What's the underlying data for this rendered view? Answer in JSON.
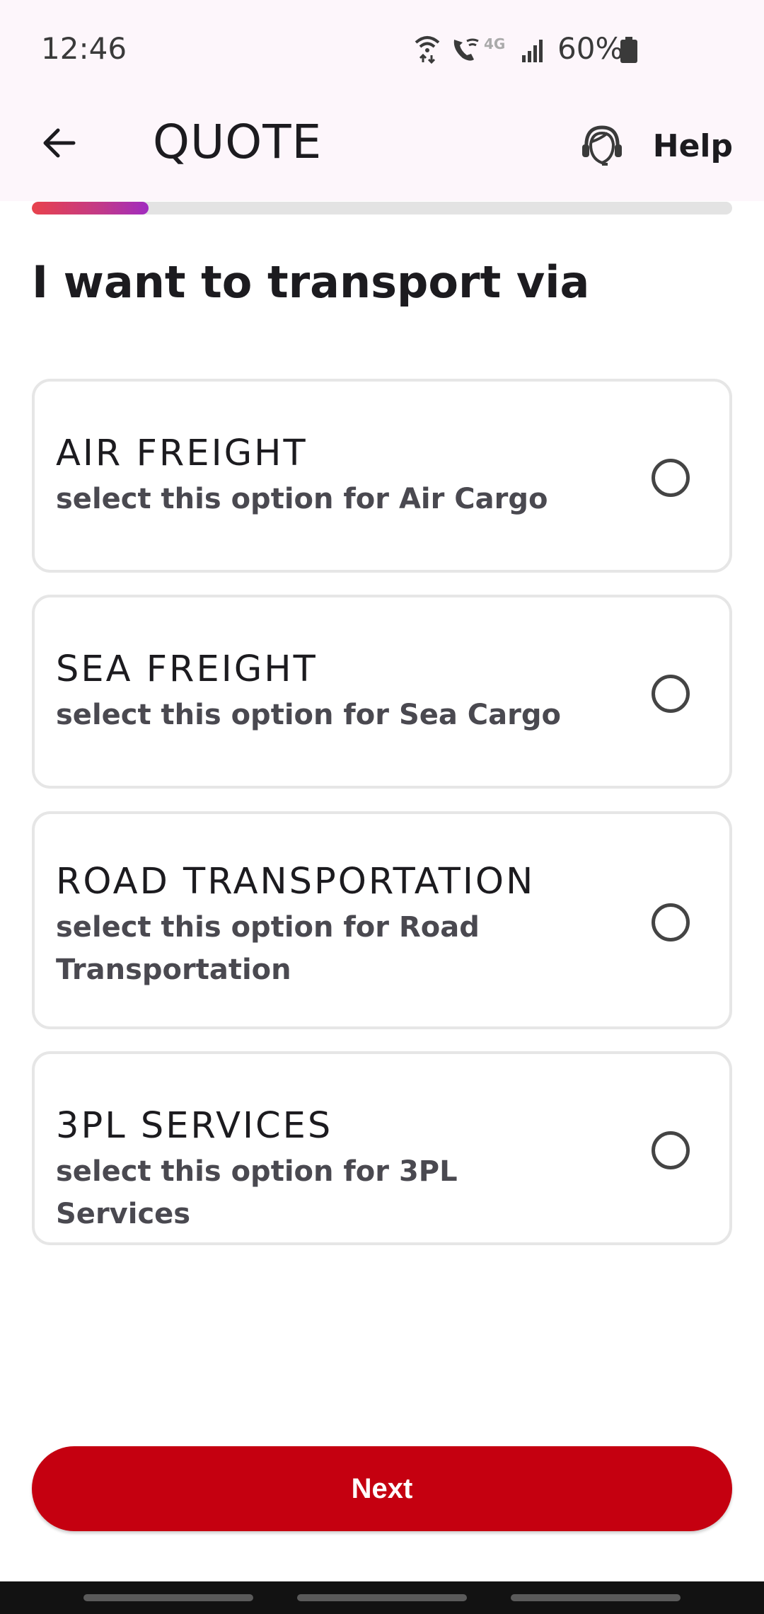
{
  "status_bar": {
    "time": "12:46",
    "battery_percent": "60%",
    "network_label": "4G",
    "icons": [
      "wifi-icon",
      "wifi-calling-icon",
      "signal-icon",
      "battery-icon"
    ]
  },
  "app_bar": {
    "title": "QUOTE",
    "back_icon": "arrow-left-icon",
    "help_label": "Help",
    "help_icon": "headset-agent-icon"
  },
  "progress": {
    "fraction": 0.167
  },
  "heading": "I want to transport via",
  "options": [
    {
      "title": "AIR FREIGHT",
      "subtitle": "select this option for Air Cargo",
      "selected": false
    },
    {
      "title": "SEA FREIGHT",
      "subtitle": "select this option for Sea Cargo",
      "selected": false
    },
    {
      "title": "ROAD TRANSPORTATION",
      "subtitle": "select this option for Road Transportation",
      "selected": false
    },
    {
      "title": "3PL SERVICES",
      "subtitle": "select this option for 3PL Services",
      "selected": false
    }
  ],
  "next_button": {
    "label": "Next"
  },
  "colors": {
    "accent": "#c50010",
    "progress_start": "#e8424c",
    "progress_end": "#a02cc0",
    "app_bar_bg": "#fdf6fb",
    "card_border": "#e6e6e6"
  }
}
